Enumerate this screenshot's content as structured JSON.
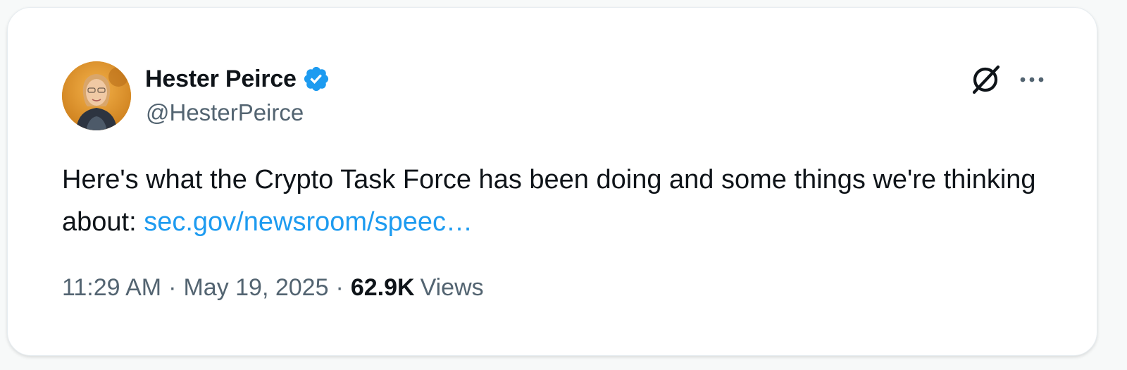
{
  "tweet": {
    "author": {
      "display_name": "Hester Peirce",
      "handle": "@HesterPeirce",
      "verified": true,
      "avatar_icon": "profile-photo"
    },
    "text_prefix": "Here's what the Crypto Task Force has been doing and some things we're thinking about: ",
    "link_text": "sec.gov/newsroom/speec…",
    "time": "11:29 AM",
    "separator": "·",
    "date": "May 19, 2025",
    "views_count": "62.9K",
    "views_label": "Views"
  },
  "icons": {
    "verified": "verified-badge-icon",
    "x_logo": "x-logo-icon",
    "more": "more-options-icon"
  },
  "colors": {
    "text_primary": "#0f1419",
    "text_secondary": "#536471",
    "link": "#1d9bf0",
    "verified": "#1d9bf0"
  }
}
